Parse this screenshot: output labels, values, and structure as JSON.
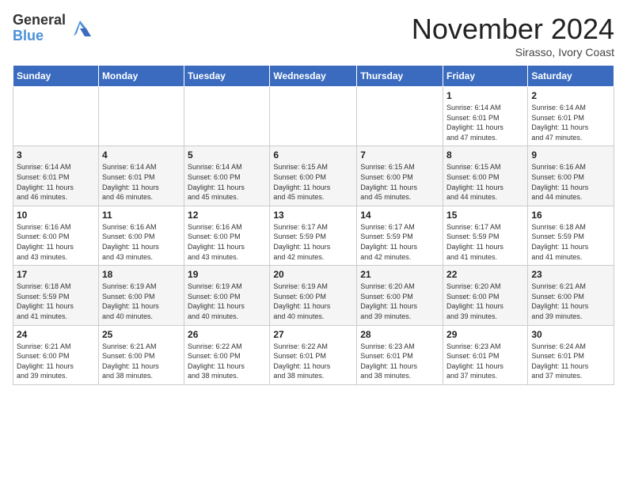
{
  "logo": {
    "general": "General",
    "blue": "Blue"
  },
  "header": {
    "month_title": "November 2024",
    "location": "Sirasso, Ivory Coast"
  },
  "weekdays": [
    "Sunday",
    "Monday",
    "Tuesday",
    "Wednesday",
    "Thursday",
    "Friday",
    "Saturday"
  ],
  "weeks": [
    [
      {
        "day": "",
        "info": ""
      },
      {
        "day": "",
        "info": ""
      },
      {
        "day": "",
        "info": ""
      },
      {
        "day": "",
        "info": ""
      },
      {
        "day": "",
        "info": ""
      },
      {
        "day": "1",
        "info": "Sunrise: 6:14 AM\nSunset: 6:01 PM\nDaylight: 11 hours\nand 47 minutes."
      },
      {
        "day": "2",
        "info": "Sunrise: 6:14 AM\nSunset: 6:01 PM\nDaylight: 11 hours\nand 47 minutes."
      }
    ],
    [
      {
        "day": "3",
        "info": "Sunrise: 6:14 AM\nSunset: 6:01 PM\nDaylight: 11 hours\nand 46 minutes."
      },
      {
        "day": "4",
        "info": "Sunrise: 6:14 AM\nSunset: 6:01 PM\nDaylight: 11 hours\nand 46 minutes."
      },
      {
        "day": "5",
        "info": "Sunrise: 6:14 AM\nSunset: 6:00 PM\nDaylight: 11 hours\nand 45 minutes."
      },
      {
        "day": "6",
        "info": "Sunrise: 6:15 AM\nSunset: 6:00 PM\nDaylight: 11 hours\nand 45 minutes."
      },
      {
        "day": "7",
        "info": "Sunrise: 6:15 AM\nSunset: 6:00 PM\nDaylight: 11 hours\nand 45 minutes."
      },
      {
        "day": "8",
        "info": "Sunrise: 6:15 AM\nSunset: 6:00 PM\nDaylight: 11 hours\nand 44 minutes."
      },
      {
        "day": "9",
        "info": "Sunrise: 6:16 AM\nSunset: 6:00 PM\nDaylight: 11 hours\nand 44 minutes."
      }
    ],
    [
      {
        "day": "10",
        "info": "Sunrise: 6:16 AM\nSunset: 6:00 PM\nDaylight: 11 hours\nand 43 minutes."
      },
      {
        "day": "11",
        "info": "Sunrise: 6:16 AM\nSunset: 6:00 PM\nDaylight: 11 hours\nand 43 minutes."
      },
      {
        "day": "12",
        "info": "Sunrise: 6:16 AM\nSunset: 6:00 PM\nDaylight: 11 hours\nand 43 minutes."
      },
      {
        "day": "13",
        "info": "Sunrise: 6:17 AM\nSunset: 5:59 PM\nDaylight: 11 hours\nand 42 minutes."
      },
      {
        "day": "14",
        "info": "Sunrise: 6:17 AM\nSunset: 5:59 PM\nDaylight: 11 hours\nand 42 minutes."
      },
      {
        "day": "15",
        "info": "Sunrise: 6:17 AM\nSunset: 5:59 PM\nDaylight: 11 hours\nand 41 minutes."
      },
      {
        "day": "16",
        "info": "Sunrise: 6:18 AM\nSunset: 5:59 PM\nDaylight: 11 hours\nand 41 minutes."
      }
    ],
    [
      {
        "day": "17",
        "info": "Sunrise: 6:18 AM\nSunset: 5:59 PM\nDaylight: 11 hours\nand 41 minutes."
      },
      {
        "day": "18",
        "info": "Sunrise: 6:19 AM\nSunset: 6:00 PM\nDaylight: 11 hours\nand 40 minutes."
      },
      {
        "day": "19",
        "info": "Sunrise: 6:19 AM\nSunset: 6:00 PM\nDaylight: 11 hours\nand 40 minutes."
      },
      {
        "day": "20",
        "info": "Sunrise: 6:19 AM\nSunset: 6:00 PM\nDaylight: 11 hours\nand 40 minutes."
      },
      {
        "day": "21",
        "info": "Sunrise: 6:20 AM\nSunset: 6:00 PM\nDaylight: 11 hours\nand 39 minutes."
      },
      {
        "day": "22",
        "info": "Sunrise: 6:20 AM\nSunset: 6:00 PM\nDaylight: 11 hours\nand 39 minutes."
      },
      {
        "day": "23",
        "info": "Sunrise: 6:21 AM\nSunset: 6:00 PM\nDaylight: 11 hours\nand 39 minutes."
      }
    ],
    [
      {
        "day": "24",
        "info": "Sunrise: 6:21 AM\nSunset: 6:00 PM\nDaylight: 11 hours\nand 39 minutes."
      },
      {
        "day": "25",
        "info": "Sunrise: 6:21 AM\nSunset: 6:00 PM\nDaylight: 11 hours\nand 38 minutes."
      },
      {
        "day": "26",
        "info": "Sunrise: 6:22 AM\nSunset: 6:00 PM\nDaylight: 11 hours\nand 38 minutes."
      },
      {
        "day": "27",
        "info": "Sunrise: 6:22 AM\nSunset: 6:01 PM\nDaylight: 11 hours\nand 38 minutes."
      },
      {
        "day": "28",
        "info": "Sunrise: 6:23 AM\nSunset: 6:01 PM\nDaylight: 11 hours\nand 38 minutes."
      },
      {
        "day": "29",
        "info": "Sunrise: 6:23 AM\nSunset: 6:01 PM\nDaylight: 11 hours\nand 37 minutes."
      },
      {
        "day": "30",
        "info": "Sunrise: 6:24 AM\nSunset: 6:01 PM\nDaylight: 11 hours\nand 37 minutes."
      }
    ]
  ]
}
